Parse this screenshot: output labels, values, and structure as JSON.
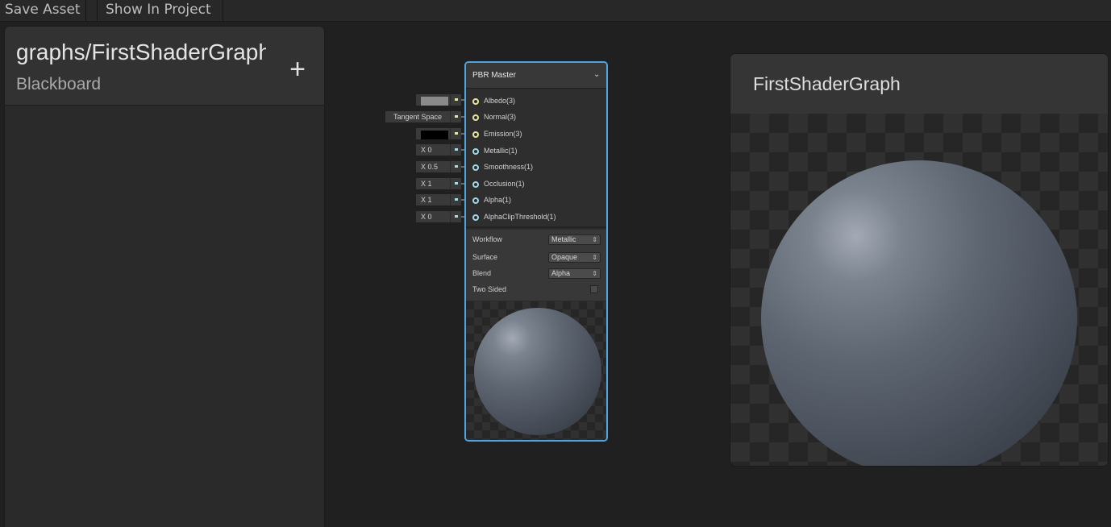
{
  "toolbar": {
    "save_asset": "Save Asset",
    "show_in_project": "Show In Project"
  },
  "blackboard": {
    "title": "graphs/FirstShaderGraph",
    "subtitle": "Blackboard",
    "add_button": "+"
  },
  "inputs": [
    {
      "field": "",
      "swatch": "#8a8a8a",
      "port": "yellow"
    },
    {
      "field": "Tangent Space",
      "swatch": null,
      "port": "yellow"
    },
    {
      "field": "",
      "swatch": "#000000",
      "port": "yellow"
    },
    {
      "field": "X 0",
      "swatch": null,
      "port": "cyan"
    },
    {
      "field": "X 0.5",
      "swatch": null,
      "port": "cyan"
    },
    {
      "field": "X 1",
      "swatch": null,
      "port": "cyan"
    },
    {
      "field": "X 1",
      "swatch": null,
      "port": "cyan"
    },
    {
      "field": "X 0",
      "swatch": null,
      "port": "cyan"
    }
  ],
  "node": {
    "title": "PBR Master",
    "collapse_icon": "chevron-down-icon",
    "slots": [
      {
        "label": "Albedo(3)",
        "port": "yellow"
      },
      {
        "label": "Normal(3)",
        "port": "yellow"
      },
      {
        "label": "Emission(3)",
        "port": "yellow"
      },
      {
        "label": "Metallic(1)",
        "port": "cyan"
      },
      {
        "label": "Smoothness(1)",
        "port": "cyan"
      },
      {
        "label": "Occlusion(1)",
        "port": "cyan"
      },
      {
        "label": "Alpha(1)",
        "port": "cyan"
      },
      {
        "label": "AlphaClipThreshold(1)",
        "port": "cyan"
      }
    ],
    "settings": {
      "workflow": {
        "label": "Workflow",
        "value": "Metallic"
      },
      "surface": {
        "label": "Surface",
        "value": "Opaque"
      },
      "blend": {
        "label": "Blend",
        "value": "Alpha"
      },
      "two_sided": {
        "label": "Two Sided",
        "checked": false
      }
    }
  },
  "preview": {
    "title": "FirstShaderGraph"
  },
  "colors": {
    "accent": "#4fa3de",
    "port_vector": "#e8e49c",
    "port_scalar": "#9fd8ea",
    "background": "#202020"
  }
}
